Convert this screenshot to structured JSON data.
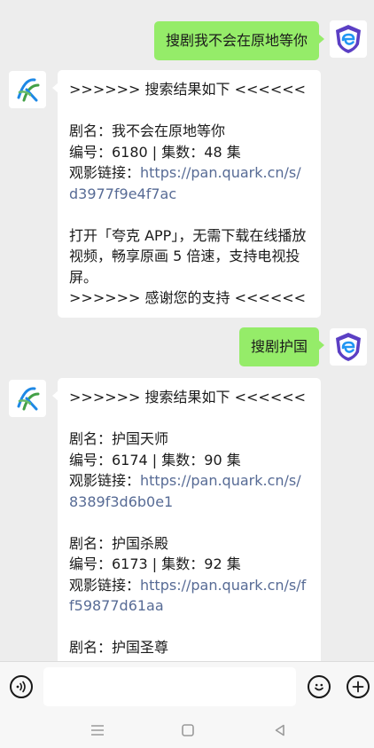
{
  "messages": {
    "m1": {
      "text": "搜剧我不会在原地等你"
    },
    "r1": {
      "lines": [
        ">>>>>> 搜索结果如下 <<<<<<",
        "",
        "剧名：我不会在原地等你",
        "编号：6180 | 集数：48 集",
        "观影链接：https://pan.quark.cn/s/d3977f9e4f7ac",
        "",
        "打开「夸克 APP」，无需下载在线播放视频，畅享原画 5 倍速，支持电视投屏。",
        ">>>>>> 感谢您的支持 <<<<<<"
      ],
      "link": "https://pan.quark.cn/s/d3977f9e4f7ac"
    },
    "m2": {
      "text": "搜剧护国"
    },
    "r2": {
      "header": ">>>>>> 搜索结果如下 <<<<<<",
      "item1": {
        "title": "剧名：护国天师",
        "meta": "编号：6174 | 集数：90 集",
        "label": "观影链接：",
        "link": "https://pan.quark.cn/s/8389f3d6b0e1"
      },
      "item2": {
        "title": "剧名：护国杀殿",
        "meta": "编号：6173 | 集数：92 集",
        "label": "观影链接：",
        "link": "https://pan.quark.cn/s/ff59877d61aa"
      },
      "item3": {
        "title": "剧名：护国圣尊"
      }
    }
  },
  "colors": {
    "my_bubble": "#95ec69",
    "link": "#576b95",
    "background": "#ededed"
  },
  "icons": {
    "user_avatar": "shield-e-logo",
    "bot_avatar": "k-logo",
    "voice": "voice-icon",
    "emoji": "emoji-icon",
    "plus": "plus-icon",
    "nav_menu": "menu-icon",
    "nav_home": "home-icon",
    "nav_back": "back-icon"
  }
}
